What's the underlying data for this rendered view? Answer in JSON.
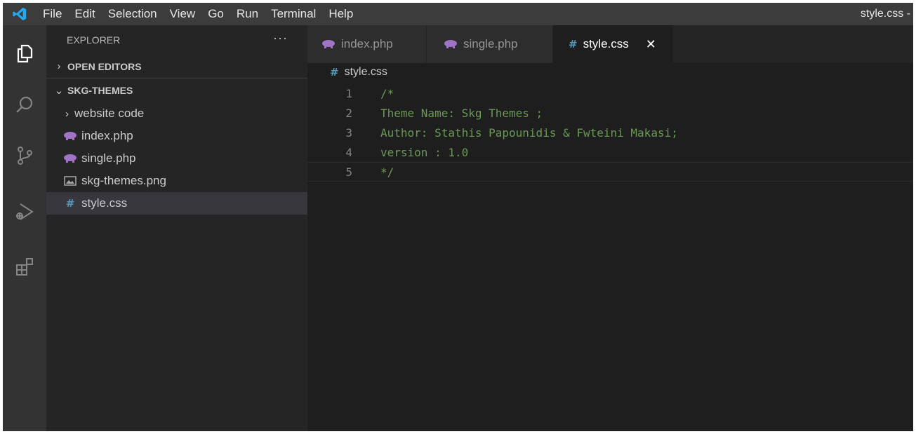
{
  "titlebar": {
    "menu": [
      "File",
      "Edit",
      "Selection",
      "View",
      "Go",
      "Run",
      "Terminal",
      "Help"
    ],
    "window_title": "style.css -"
  },
  "activity_bar": {
    "icons": [
      "explorer-icon",
      "search-icon",
      "source-control-icon",
      "run-debug-icon",
      "extensions-icon"
    ]
  },
  "sidebar": {
    "title": "EXPLORER",
    "more": "···",
    "open_editors": "OPEN EDITORS",
    "workspace": "SKG-THEMES",
    "items": [
      {
        "label": "website code",
        "type": "folder"
      },
      {
        "label": "index.php",
        "type": "php"
      },
      {
        "label": "single.php",
        "type": "php"
      },
      {
        "label": "skg-themes.png",
        "type": "image"
      },
      {
        "label": "style.css",
        "type": "css",
        "selected": true
      }
    ]
  },
  "tabs": [
    {
      "label": "index.php",
      "icon": "php-icon",
      "active": false
    },
    {
      "label": "single.php",
      "icon": "php-icon",
      "active": false
    },
    {
      "label": "style.css",
      "icon": "css-hash-icon",
      "active": true,
      "close": "✕"
    }
  ],
  "breadcrumb": {
    "file": "style.css"
  },
  "code": {
    "lines": [
      {
        "number": "1",
        "text": "/*"
      },
      {
        "number": "2",
        "text": "Theme Name: Skg Themes ;"
      },
      {
        "number": "3",
        "text": "Author: Stathis Papounidis & Fwteini Makasi;"
      },
      {
        "number": "4",
        "text": "version : 1.0"
      },
      {
        "number": "5",
        "text": "*/"
      }
    ]
  },
  "colors": {
    "titlebar": "#3c3c3c",
    "activity_bar": "#333333",
    "sidebar": "#252526",
    "editor": "#1e1e1e",
    "comment": "#6a9955",
    "php_icon": "#a074c4",
    "css_hash": "#519aba"
  }
}
